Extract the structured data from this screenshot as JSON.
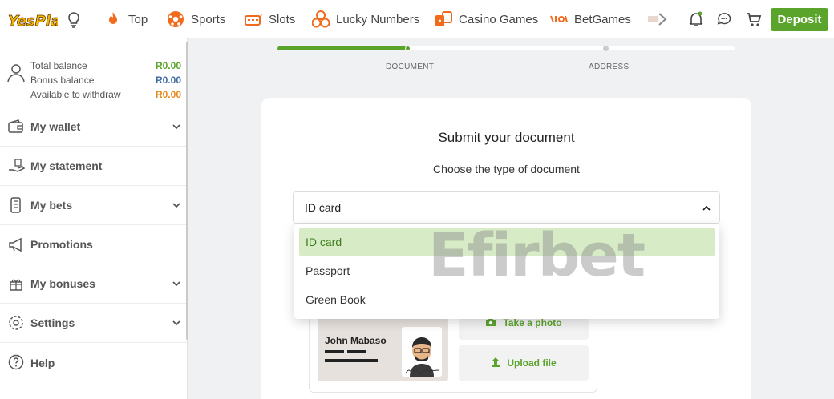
{
  "nav": {
    "brand_logo_text": "YesPlay",
    "items": [
      {
        "label": "Top",
        "icon": "flame-icon"
      },
      {
        "label": "Sports",
        "icon": "soccer-ball-icon"
      },
      {
        "label": "Slots",
        "icon": "slot-machine-icon"
      },
      {
        "label": "Lucky Numbers",
        "icon": "lottery-balls-icon"
      },
      {
        "label": "Casino Games",
        "icon": "dice-icon"
      },
      {
        "label": "BetGames",
        "icon": "betgames-icon"
      }
    ],
    "deposit_label": "Deposit"
  },
  "sidebar": {
    "balance": {
      "total_label": "Total balance",
      "total_value": "R0.00",
      "bonus_label": "Bonus balance",
      "bonus_value": "R0.00",
      "withdraw_label": "Available to withdraw",
      "withdraw_value": "R0.00"
    },
    "items": [
      {
        "label": "My wallet",
        "icon": "wallet-icon",
        "expandable": true
      },
      {
        "label": "My statement",
        "icon": "statement-icon",
        "expandable": false
      },
      {
        "label": "My bets",
        "icon": "bets-icon",
        "expandable": true
      },
      {
        "label": "Promotions",
        "icon": "megaphone-icon",
        "expandable": false
      },
      {
        "label": "My bonuses",
        "icon": "gift-icon",
        "expandable": true
      },
      {
        "label": "Settings",
        "icon": "gear-icon",
        "expandable": true
      },
      {
        "label": "Help",
        "icon": "help-icon",
        "expandable": false
      }
    ]
  },
  "progress": {
    "steps": [
      "DOCUMENT",
      "ADDRESS"
    ],
    "current_step": 1
  },
  "form": {
    "title": "Submit your document",
    "subtitle": "Choose the type of document",
    "selected_value": "ID card",
    "options": [
      "ID card",
      "Passport",
      "Green Book"
    ],
    "sample_name": "John Mabaso",
    "take_photo_label": "Take a photo",
    "upload_label": "Upload file"
  },
  "watermark": "Efirbet",
  "colors": {
    "accent": "#5aa42c",
    "balance_green": "#5aa42c",
    "balance_blue": "#3e6aa8",
    "balance_orange": "#e8871e"
  }
}
